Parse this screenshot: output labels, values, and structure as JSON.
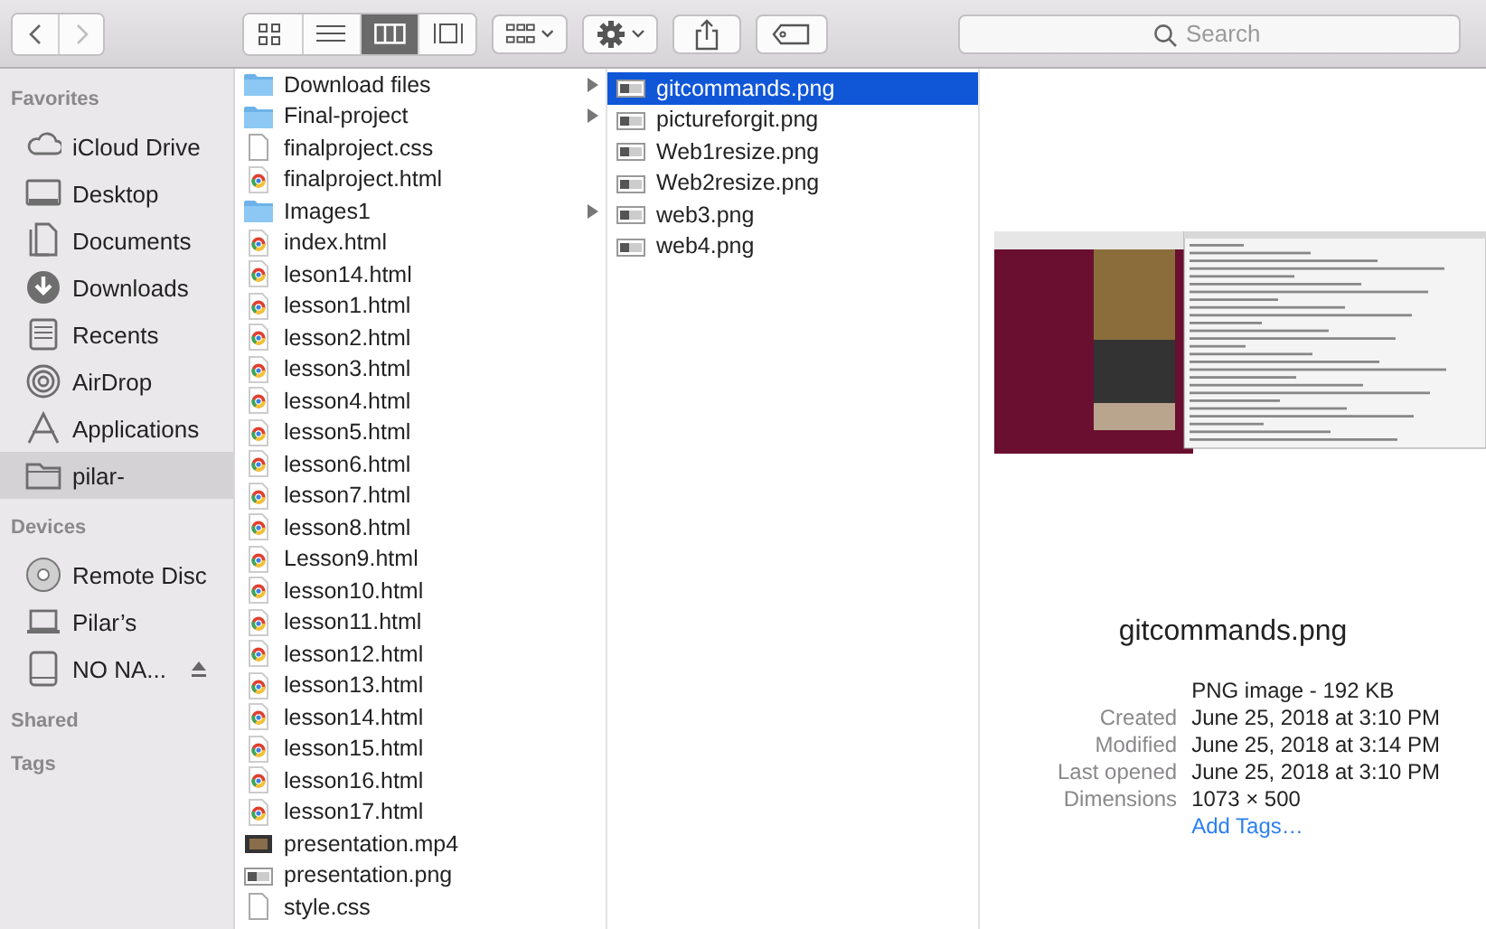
{
  "toolbar": {
    "nav": [
      {
        "kind": "back",
        "disabled": false
      },
      {
        "kind": "forward",
        "disabled": true
      }
    ],
    "view_modes": [
      {
        "kind": "icons",
        "selected": false
      },
      {
        "kind": "list",
        "selected": false
      },
      {
        "kind": "columns",
        "selected": true
      },
      {
        "kind": "gallery",
        "selected": false
      }
    ],
    "actions": [
      {
        "kind": "group"
      },
      {
        "kind": "gear"
      },
      {
        "kind": "share"
      },
      {
        "kind": "tag"
      }
    ],
    "search": {
      "placeholder": "Search"
    }
  },
  "sidebar": [
    {
      "heading": "Favorites",
      "items": [
        {
          "label": "iCloud Drive",
          "kind": "cloud",
          "selected": false
        },
        {
          "label": "Desktop",
          "kind": "desktop",
          "selected": false
        },
        {
          "label": "Documents",
          "kind": "documents",
          "selected": false
        },
        {
          "label": "Downloads",
          "kind": "downloads",
          "selected": false
        },
        {
          "label": "Recents",
          "kind": "recents",
          "selected": false
        },
        {
          "label": "AirDrop",
          "kind": "airdrop",
          "selected": false
        },
        {
          "label": "Applications",
          "kind": "applications",
          "selected": false
        },
        {
          "label": "pilar-",
          "kind": "folder",
          "selected": true
        }
      ]
    },
    {
      "heading": "Devices",
      "items": [
        {
          "label": "Remote Disc",
          "kind": "disc",
          "selected": false
        },
        {
          "label": "Pilar’s",
          "kind": "laptop",
          "selected": false
        },
        {
          "label": "NO NA...",
          "kind": "drive",
          "selected": false,
          "eject": true
        }
      ]
    },
    {
      "heading": "Shared"
    },
    {
      "heading": "Tags"
    }
  ],
  "columns": [
    {
      "items": [
        {
          "name": "Download files",
          "kind": "folder",
          "selected": false
        },
        {
          "name": "Final-project",
          "kind": "folder",
          "selected": false
        },
        {
          "name": "finalproject.css",
          "kind": "doc",
          "selected": false
        },
        {
          "name": "finalproject.html",
          "kind": "html",
          "selected": false
        },
        {
          "name": "Images1",
          "kind": "folder",
          "selected": false
        },
        {
          "name": "index.html",
          "kind": "html",
          "selected": false
        },
        {
          "name": "leson14.html",
          "kind": "html",
          "selected": false
        },
        {
          "name": "lesson1.html",
          "kind": "html",
          "selected": false
        },
        {
          "name": "lesson2.html",
          "kind": "html",
          "selected": false
        },
        {
          "name": "lesson3.html",
          "kind": "html",
          "selected": false
        },
        {
          "name": "lesson4.html",
          "kind": "html",
          "selected": false
        },
        {
          "name": "lesson5.html",
          "kind": "html",
          "selected": false
        },
        {
          "name": "lesson6.html",
          "kind": "html",
          "selected": false
        },
        {
          "name": "lesson7.html",
          "kind": "html",
          "selected": false
        },
        {
          "name": "lesson8.html",
          "kind": "html",
          "selected": false
        },
        {
          "name": "Lesson9.html",
          "kind": "html",
          "selected": false
        },
        {
          "name": "lesson10.html",
          "kind": "html",
          "selected": false
        },
        {
          "name": "lesson11.html",
          "kind": "html",
          "selected": false
        },
        {
          "name": "lesson12.html",
          "kind": "html",
          "selected": false
        },
        {
          "name": "lesson13.html",
          "kind": "html",
          "selected": false
        },
        {
          "name": "lesson14.html",
          "kind": "html",
          "selected": false
        },
        {
          "name": "lesson15.html",
          "kind": "html",
          "selected": false
        },
        {
          "name": "lesson16.html",
          "kind": "html",
          "selected": false
        },
        {
          "name": "lesson17.html",
          "kind": "html",
          "selected": false
        },
        {
          "name": "presentation.mp4",
          "kind": "video",
          "selected": false
        },
        {
          "name": "presentation.png",
          "kind": "image",
          "selected": false
        },
        {
          "name": "style.css",
          "kind": "doc",
          "selected": false
        }
      ]
    },
    {
      "items": [
        {
          "name": "gitcommands.png",
          "kind": "image",
          "selected": true
        },
        {
          "name": "pictureforgit.png",
          "kind": "image",
          "selected": false
        },
        {
          "name": "Web1resize.png",
          "kind": "image",
          "selected": false
        },
        {
          "name": "Web2resize.png",
          "kind": "image",
          "selected": false
        },
        {
          "name": "web3.png",
          "kind": "image",
          "selected": false
        },
        {
          "name": "web4.png",
          "kind": "image",
          "selected": false
        }
      ]
    }
  ],
  "preview": {
    "name": "gitcommands.png",
    "type_size": "PNG image - 192 KB",
    "info": [
      {
        "label": "Created",
        "value": "June 25, 2018 at 3:10 PM"
      },
      {
        "label": "Modified",
        "value": "June 25, 2018 at 3:14 PM"
      },
      {
        "label": "Last opened",
        "value": "June 25, 2018 at 3:10 PM"
      },
      {
        "label": "Dimensions",
        "value": "1073 × 500"
      }
    ],
    "add_tags": "Add Tags…"
  }
}
